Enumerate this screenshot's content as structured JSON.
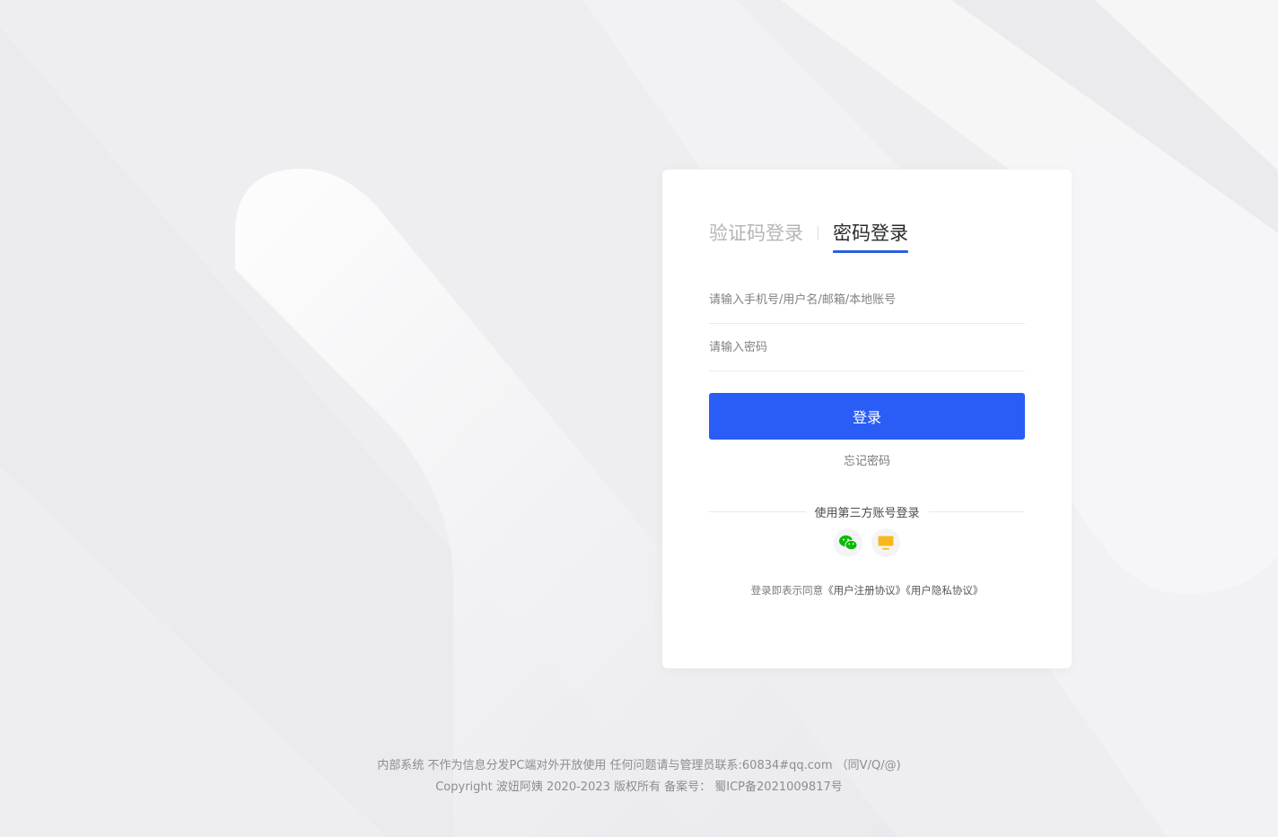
{
  "login": {
    "tabs": [
      {
        "label": "验证码登录",
        "active": false
      },
      {
        "label": "密码登录",
        "active": true
      }
    ],
    "username_placeholder": "请输入手机号/用户名/邮箱/本地账号",
    "password_placeholder": "请输入密码",
    "submit_label": "登录",
    "forgot_label": "忘记密码",
    "third_party_label": "使用第三方账号登录",
    "third_party": [
      {
        "name": "wechat",
        "icon": "wechat-icon",
        "color": "#09bb07"
      },
      {
        "name": "other",
        "icon": "monitor-icon",
        "color": "#f8b81c"
      }
    ],
    "agreement_prefix": "登录即表示同意",
    "agreement_user": "《用户注册协议》",
    "agreement_privacy": "《用户隐私协议》"
  },
  "colors": {
    "accent": "#2a5cf6",
    "tab_underline": "#2c5fe0"
  },
  "footer": {
    "line1": "内部系统 不作为信息分发PC端对外开放使用 任何问题请与管理员联系:60834#qq.com （同V/Q/@)",
    "line2": "Copyright 波妞阿姨 2020-2023 版权所有   备案号：  蜀ICP备2021009817号"
  }
}
